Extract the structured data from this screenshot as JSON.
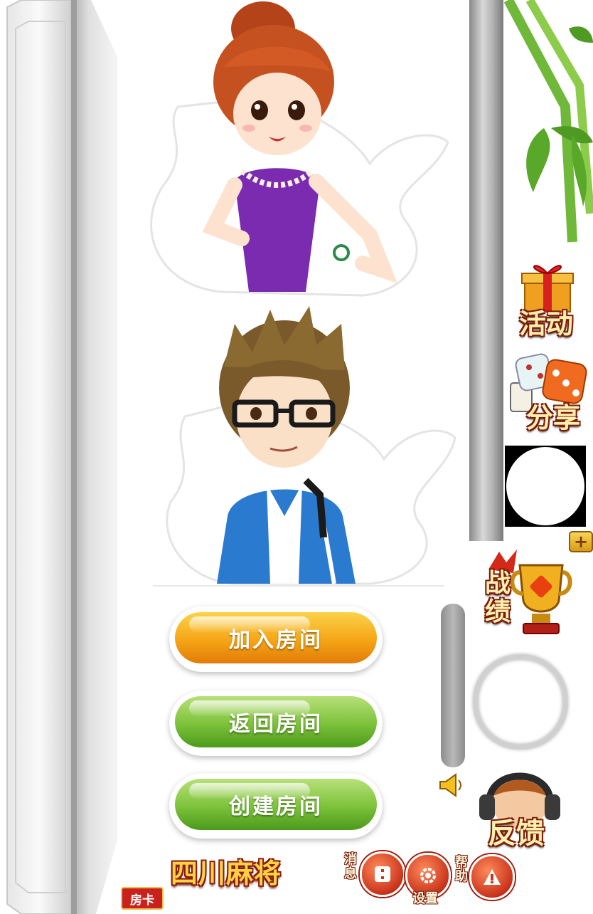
{
  "buttons": {
    "join_room": "加入房间",
    "return_room": "返回房间",
    "create_room": "创建房间"
  },
  "sidebar": {
    "activity": "活动",
    "share": "分享",
    "record": "战绩",
    "feedback": "反馈"
  },
  "bottom": {
    "game_title": "四川麻将",
    "room_card": "房卡",
    "message": "消息",
    "settings": "设置",
    "help": "帮助"
  },
  "icons": {
    "plus": "+"
  },
  "colors": {
    "join_button": "#f5a516",
    "green_button": "#7cc23a",
    "label_outline": "#7a1d0a",
    "title_fill": "#ffd246"
  }
}
